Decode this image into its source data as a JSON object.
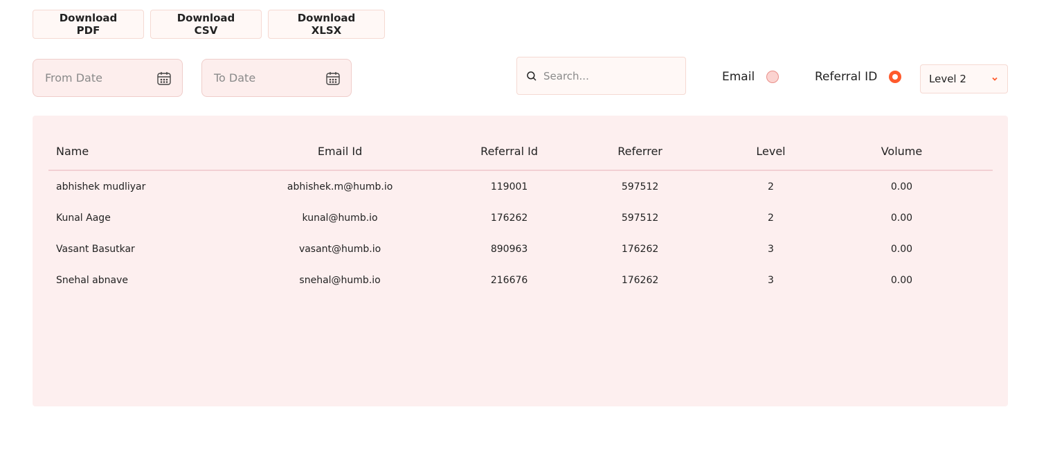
{
  "downloads": {
    "pdf_label": "Download PDF",
    "csv_label": "Download CSV",
    "xlsx_label": "Download XLSX"
  },
  "filters": {
    "from_date_placeholder": "From Date",
    "to_date_placeholder": "To Date",
    "search_placeholder": "Search...",
    "search_value": "",
    "email_label": "Email",
    "email_selected": false,
    "referral_label": "Referral ID",
    "referral_selected": true,
    "level_value": "Level 2"
  },
  "colors": {
    "accent": "#ff5a2c",
    "panel_bg": "#fdefef"
  },
  "icons": {
    "calendar": "calendar-icon",
    "search": "search-icon",
    "chevron": "chevron-down-icon"
  },
  "table": {
    "columns": [
      "Name",
      "Email Id",
      "Referral Id",
      "Referrer",
      "Level",
      "Volume"
    ],
    "rows": [
      [
        "abhishek mudliyar",
        "abhishek.m@humb.io",
        "119001",
        "597512",
        "2",
        "0.00"
      ],
      [
        "Kunal Aage",
        "kunal@humb.io",
        "176262",
        "597512",
        "2",
        "0.00"
      ],
      [
        "Vasant Basutkar",
        "vasant@humb.io",
        "890963",
        "176262",
        "3",
        "0.00"
      ],
      [
        "Snehal abnave",
        "snehal@humb.io",
        "216676",
        "176262",
        "3",
        "0.00"
      ]
    ]
  }
}
